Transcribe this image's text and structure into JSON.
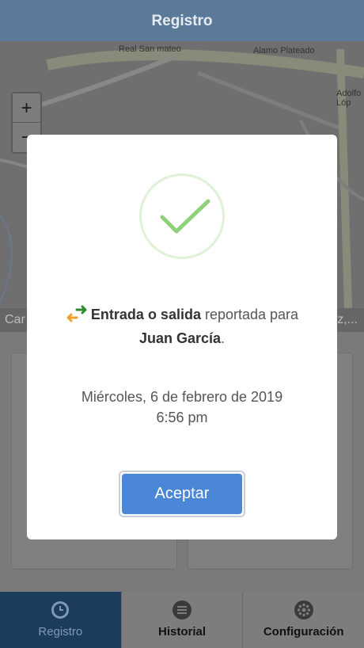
{
  "header": {
    "title": "Registro"
  },
  "map": {
    "labels": {
      "real_san_mateo": "Real San mateo",
      "alamo_plateado": "Alamo Plateado",
      "adolfo": "Adolfo Lóp",
      "zoom_in": "+",
      "zoom_out": "−"
    },
    "address_left": "Car",
    "address_right": "z,..."
  },
  "modal": {
    "message_bold": "Entrada o salida",
    "message_rest": " reportada para",
    "employee": "Juan García",
    "employee_suffix": ".",
    "date": "Miércoles, 6 de febrero de 2019",
    "time": "6:56 pm",
    "accept_label": "Aceptar"
  },
  "tabs": [
    {
      "label": "Registro",
      "icon": "clock-icon"
    },
    {
      "label": "Historial",
      "icon": "list-icon"
    },
    {
      "label": "Configuración",
      "icon": "gear-icon"
    }
  ],
  "colors": {
    "header": "#5b7a9a",
    "accept_button": "#4a87d6",
    "check": "#8fd07a",
    "active_tab": "#1c3c5d",
    "arrow_green": "#2e8b2e",
    "arrow_orange": "#f0a030"
  }
}
